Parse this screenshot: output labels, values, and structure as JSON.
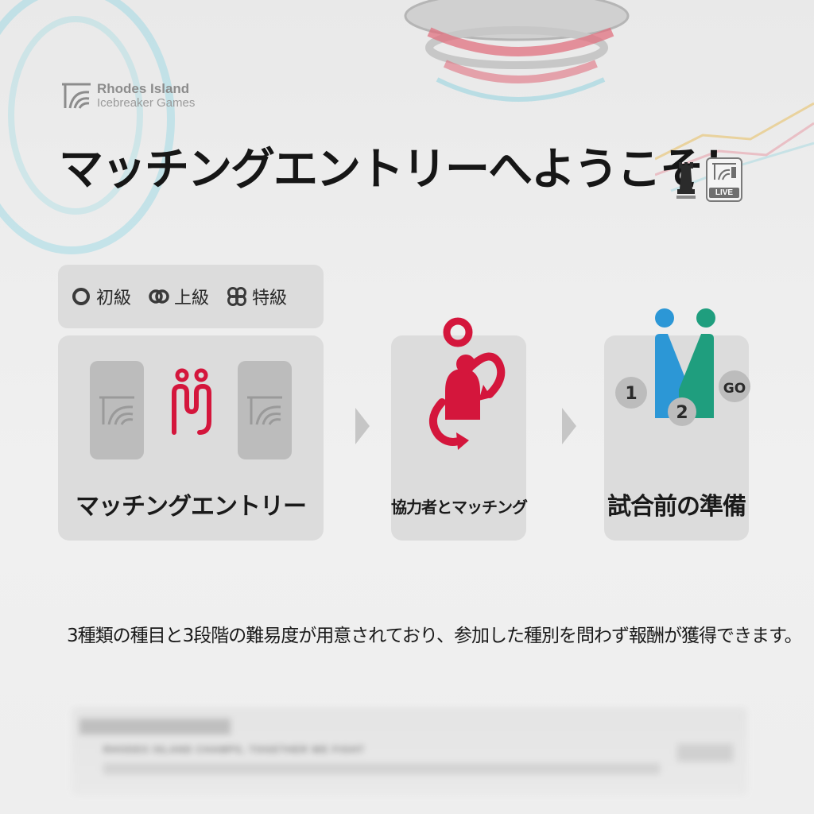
{
  "brand": {
    "name": "Rhodes Island",
    "subtitle": "Icebreaker Games"
  },
  "header": {
    "title": "マッチングエントリーへようこそ！",
    "live_label": "LIVE"
  },
  "difficulty": [
    {
      "label": "初級",
      "icon": "beginner-icon"
    },
    {
      "label": "上級",
      "icon": "advanced-icon"
    },
    {
      "label": "特級",
      "icon": "expert-icon"
    }
  ],
  "steps": [
    {
      "label": "マッチングエントリー",
      "icon": "entry-icon"
    },
    {
      "label": "協力者とマッチング",
      "icon": "match-partner-icon"
    },
    {
      "label": "試合前の準備",
      "icon": "pre-match-icon"
    }
  ],
  "prep_badges": {
    "first": "1",
    "second": "2",
    "go": "GO"
  },
  "description": "3種類の種目と3段階の難易度が用意されており、参加した種別を問わず報酬が獲得できます。",
  "banner": {
    "text": "RHODES ISLAND CHAMPS, TOGETHER WE FIGHT"
  },
  "colors": {
    "accent_red": "#d4163c",
    "accent_blue": "#2c97d6",
    "accent_green": "#1f9e7e",
    "panel": "#dcdcdc",
    "tile": "#bcbcbc"
  }
}
